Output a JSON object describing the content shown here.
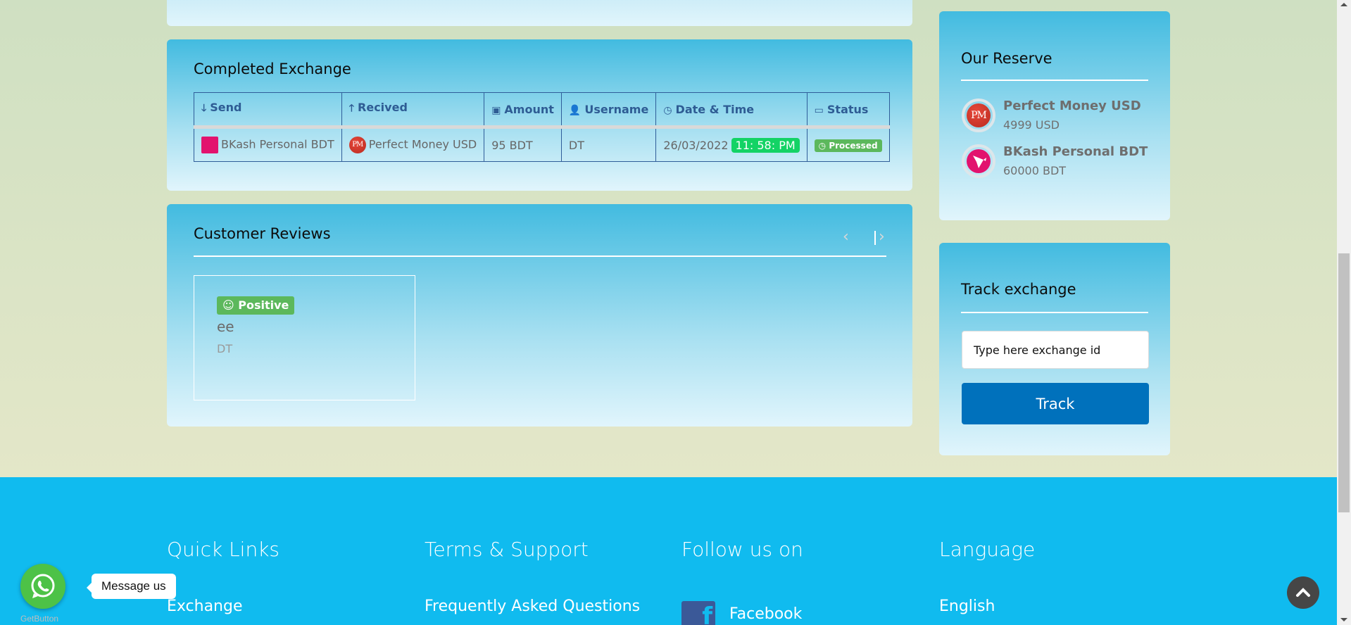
{
  "completed_exchange": {
    "title": "Completed Exchange",
    "columns": [
      {
        "icon": "arrow-down-icon",
        "glyph": "🡓",
        "label": "Send"
      },
      {
        "icon": "arrow-up-icon",
        "glyph": "🡑",
        "label": "Recived"
      },
      {
        "icon": "money-icon",
        "glyph": "▣",
        "label": "Amount"
      },
      {
        "icon": "user-icon",
        "glyph": "👤",
        "label": "Username"
      },
      {
        "icon": "clock-icon",
        "glyph": "◷",
        "label": "Date & Time"
      },
      {
        "icon": "calendar-icon",
        "glyph": "▭",
        "label": "Status"
      }
    ],
    "rows": [
      {
        "send": "BKash Personal BDT",
        "received": "Perfect Money USD",
        "received_logo": "PM",
        "amount": "95 BDT",
        "username": "DT",
        "date": "26/03/2022",
        "time": "11: 58: PM",
        "status": "Processed",
        "status_glyph": "◷"
      }
    ]
  },
  "reviews": {
    "title": "Customer Reviews",
    "prev_glyph": "‹",
    "next_glyph": "›",
    "items": [
      {
        "sentiment": "Positive",
        "sentiment_glyph": "☺",
        "text": "ee",
        "user": "DT"
      }
    ]
  },
  "reserve": {
    "title": "Our Reserve",
    "items": [
      {
        "name": "Perfect Money USD",
        "amount": "4999 USD",
        "logo": "PM"
      },
      {
        "name": "BKash Personal BDT",
        "amount": "60000 BDT",
        "logo": ""
      }
    ]
  },
  "track": {
    "title": "Track exchange",
    "placeholder": "Type here exchange id",
    "button": "Track"
  },
  "footer": {
    "quick_links": {
      "title": "Quick Links",
      "first_link": "Exchange"
    },
    "terms": {
      "title": "Terms & Support",
      "first_link": "Frequently Asked Questions"
    },
    "follow": {
      "title": "Follow us on",
      "first_link": "Facebook",
      "fb_glyph": "f"
    },
    "language": {
      "title": "Language",
      "first_link": "English"
    }
  },
  "widgets": {
    "whatsapp_label": "GetButton",
    "message_bubble": "Message us",
    "scroll_top_glyph": "⌃"
  },
  "colors": {
    "footer_bg": "#10bbef",
    "track_button": "#0071bc",
    "positive_badge": "#5cb85c",
    "time_badge": "#13d365",
    "table_header_text": "#2e5c94"
  }
}
